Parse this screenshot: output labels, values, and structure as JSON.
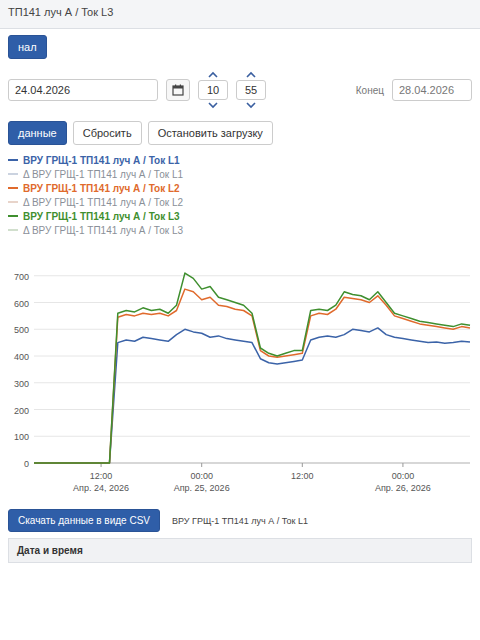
{
  "window": {
    "title": "ТП141 луч А / Ток L3"
  },
  "toolbar": {
    "channel_button": "нал",
    "start_date": "24.04.2026",
    "hour": "10",
    "minute": "55",
    "end_label": "Конец",
    "end_date": "28.04.2026"
  },
  "actions": [
    {
      "label": "данные",
      "primary": true
    },
    {
      "label": "Сбросить",
      "primary": false
    },
    {
      "label": "Остановить загрузку",
      "primary": false
    }
  ],
  "legend": [
    {
      "label": "ВРУ ГРЩ-1 ТП141 луч А / Ток L1",
      "visible": true,
      "color": "#3b63a8"
    },
    {
      "label": "Δ ВРУ ГРЩ-1 ТП141 луч А / Ток L1",
      "visible": false,
      "color": "#a9b6cc"
    },
    {
      "label": "ВРУ ГРЩ-1 ТП141 луч А / Ток L2",
      "visible": true,
      "color": "#e06a2c"
    },
    {
      "label": "Δ ВРУ ГРЩ-1 ТП141 луч А / Ток L2",
      "visible": false,
      "color": "#d9b8a6"
    },
    {
      "label": "ВРУ ГРЩ-1 ТП141 луч А / Ток L3",
      "visible": true,
      "color": "#3f8f2f"
    },
    {
      "label": "Δ ВРУ ГРЩ-1 ТП141 луч А / Ток L3",
      "visible": false,
      "color": "#b3c9ab"
    }
  ],
  "chart": {
    "y_ticks": [
      "0",
      "100",
      "200",
      "300",
      "400",
      "500",
      "600",
      "700"
    ],
    "x_ticks": [
      {
        "index": 8,
        "time": "12:00",
        "date": "Апр. 24, 2026"
      },
      {
        "index": 20,
        "time": "00:00",
        "date": "Апр. 25, 2026"
      },
      {
        "index": 32,
        "time": "12:00",
        "date": ""
      },
      {
        "index": 44,
        "time": "00:00",
        "date": "Апр. 26, 2026"
      }
    ],
    "series": [
      {
        "name": "Ток L1",
        "color": "#3b63a8",
        "values": [
          0,
          0,
          0,
          0,
          0,
          0,
          0,
          0,
          0,
          0,
          450,
          460,
          455,
          470,
          465,
          460,
          455,
          480,
          500,
          490,
          485,
          470,
          475,
          465,
          460,
          455,
          450,
          390,
          375,
          370,
          375,
          380,
          385,
          460,
          470,
          475,
          470,
          480,
          500,
          495,
          490,
          505,
          480,
          470,
          465,
          460,
          455,
          450,
          452,
          448,
          450,
          455,
          452
        ]
      },
      {
        "name": "Ток L2",
        "color": "#e06a2c",
        "values": [
          0,
          0,
          0,
          0,
          0,
          0,
          0,
          0,
          0,
          0,
          545,
          555,
          550,
          560,
          555,
          560,
          550,
          570,
          650,
          640,
          610,
          620,
          590,
          585,
          575,
          570,
          550,
          420,
          400,
          395,
          400,
          405,
          410,
          550,
          560,
          555,
          575,
          620,
          615,
          610,
          600,
          625,
          590,
          550,
          540,
          530,
          520,
          515,
          510,
          505,
          500,
          510,
          505
        ]
      },
      {
        "name": "Ток L3",
        "color": "#3f8f2f",
        "values": [
          0,
          0,
          0,
          0,
          0,
          0,
          0,
          0,
          0,
          0,
          560,
          570,
          565,
          580,
          570,
          575,
          560,
          590,
          710,
          690,
          650,
          660,
          620,
          610,
          600,
          590,
          560,
          430,
          410,
          400,
          410,
          420,
          420,
          570,
          575,
          570,
          590,
          640,
          630,
          625,
          610,
          640,
          600,
          560,
          550,
          540,
          530,
          525,
          520,
          515,
          510,
          520,
          515
        ]
      }
    ]
  },
  "footer": {
    "download_button": "Скачать данные в виде CSV",
    "caption": "ВРУ ГРЩ-1 ТП141 луч А / Ток L1",
    "table_columns": [
      "Дата и время"
    ]
  }
}
